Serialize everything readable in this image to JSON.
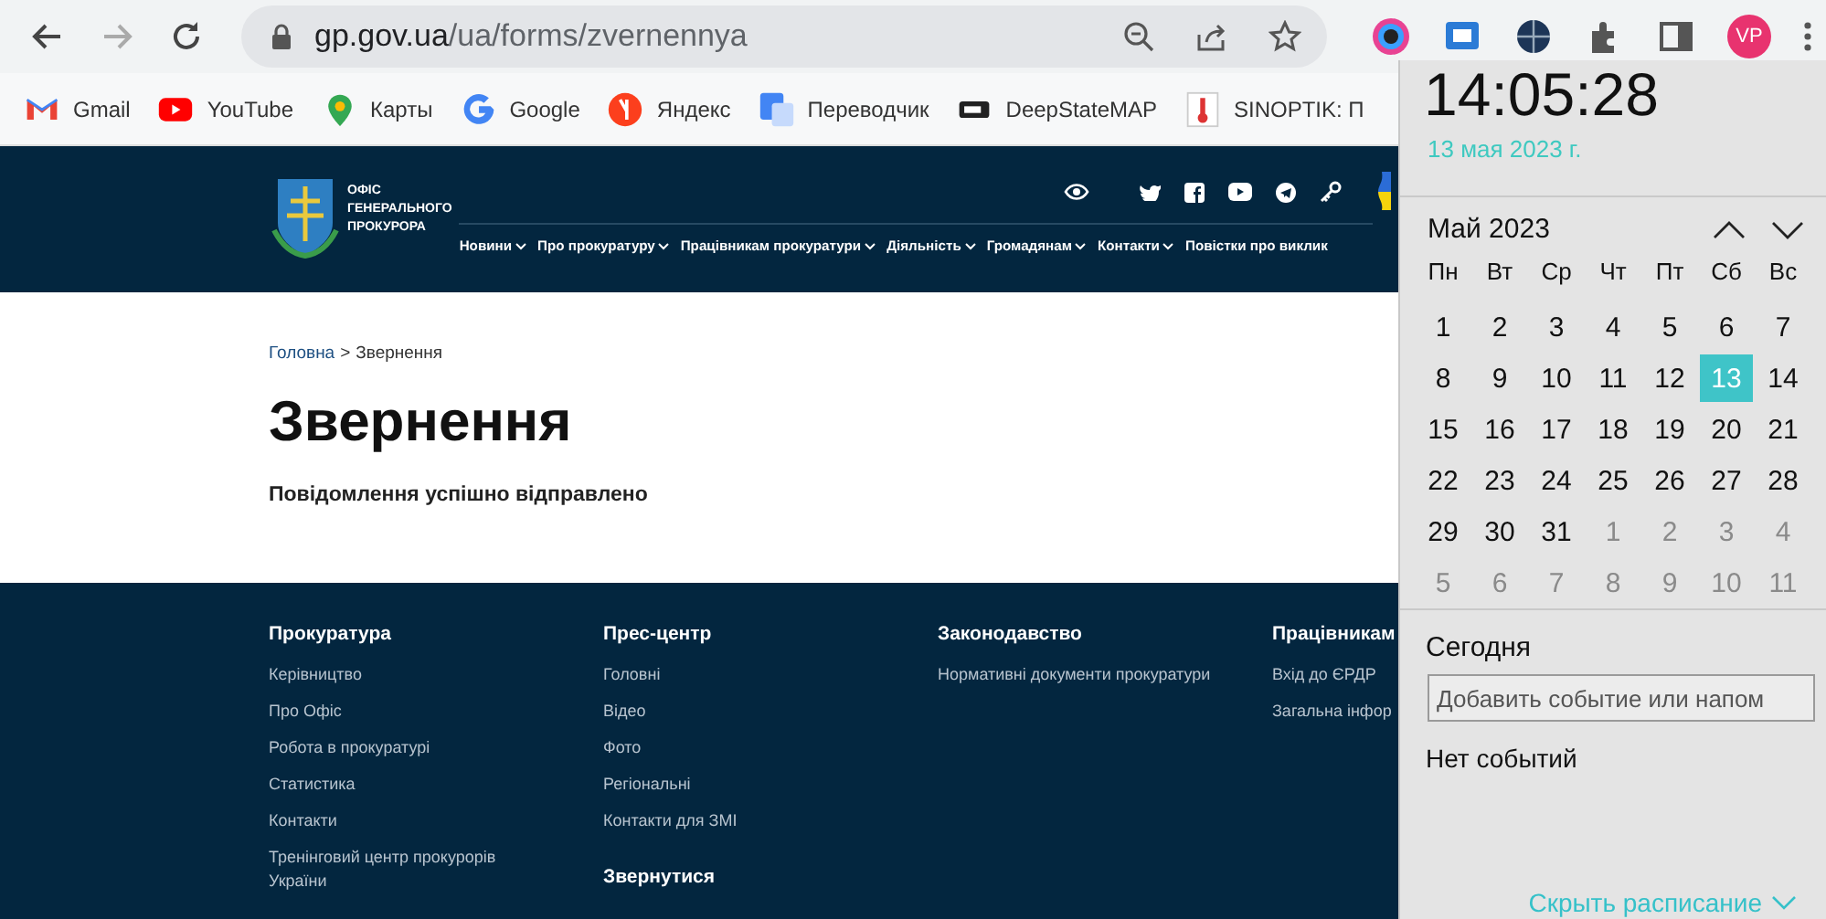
{
  "browser": {
    "url_host": "gp.gov.ua",
    "url_path": "/ua/forms/zvernennya",
    "avatar": "VP",
    "bookmarks": [
      {
        "label": "Gmail"
      },
      {
        "label": "YouTube"
      },
      {
        "label": "Карты"
      },
      {
        "label": "Google"
      },
      {
        "label": "Яндекс"
      },
      {
        "label": "Переводчик"
      },
      {
        "label": "DeepStateMAP"
      },
      {
        "label": "SINOPTIK: П"
      }
    ]
  },
  "site": {
    "logo_text": "ОФІС\nГЕНЕРАЛЬНОГО\nПРОКУРОРА",
    "nav": [
      {
        "label": "Новини",
        "has_menu": true
      },
      {
        "label": "Про прокуратуру",
        "has_menu": true
      },
      {
        "label": "Працівникам прокуратури",
        "has_menu": true
      },
      {
        "label": "Діяльність",
        "has_menu": true
      },
      {
        "label": "Громадянам",
        "has_menu": true
      },
      {
        "label": "Контакти",
        "has_menu": true
      },
      {
        "label": "Повістки про виклик",
        "has_menu": false
      }
    ],
    "breadcrumb": [
      {
        "label": "Головна",
        "link": true
      },
      {
        "label": "Звернення",
        "link": false
      }
    ],
    "breadcrumb_separator": ">",
    "title": "Звернення",
    "message": "Повідомлення успішно відправлено",
    "footer": [
      {
        "sections": [
          {
            "heading": "Прокуратура",
            "links": [
              "Керівництво",
              "Про Офіс",
              "Робота в прокуратурі",
              "Статистика",
              "Контакти",
              "Тренінговий центр прокурорів України"
            ]
          }
        ]
      },
      {
        "sections": [
          {
            "heading": "Прес-центр",
            "links": [
              "Головні",
              "Відео",
              "Фото",
              "Регіональні",
              "Контакти для ЗМІ"
            ]
          },
          {
            "heading": "Звернутися"
          }
        ]
      },
      {
        "sections": [
          {
            "heading": "Законодавство",
            "links": [
              "Нормативні документи прокуратури"
            ]
          }
        ]
      },
      {
        "sections": [
          {
            "heading": "Працівникам",
            "links": [
              "Вхід до ЄРДР",
              "Загальна інфор"
            ]
          }
        ]
      }
    ]
  },
  "calendar": {
    "time": "14:05:28",
    "date": "13 мая 2023 г.",
    "month": "Май 2023",
    "weekdays": [
      "Пн",
      "Вт",
      "Ср",
      "Чт",
      "Пт",
      "Сб",
      "Вс"
    ],
    "weeks": [
      [
        {
          "day": "1",
          "other_month": false,
          "selected": false
        },
        {
          "day": "2",
          "other_month": false,
          "selected": false
        },
        {
          "day": "3",
          "other_month": false,
          "selected": false
        },
        {
          "day": "4",
          "other_month": false,
          "selected": false
        },
        {
          "day": "5",
          "other_month": false,
          "selected": false
        },
        {
          "day": "6",
          "other_month": false,
          "selected": false
        },
        {
          "day": "7",
          "other_month": false,
          "selected": false
        }
      ],
      [
        {
          "day": "8",
          "other_month": false,
          "selected": false
        },
        {
          "day": "9",
          "other_month": false,
          "selected": false
        },
        {
          "day": "10",
          "other_month": false,
          "selected": false
        },
        {
          "day": "11",
          "other_month": false,
          "selected": false
        },
        {
          "day": "12",
          "other_month": false,
          "selected": false
        },
        {
          "day": "13",
          "other_month": false,
          "selected": true
        },
        {
          "day": "14",
          "other_month": false,
          "selected": false
        }
      ],
      [
        {
          "day": "15",
          "other_month": false,
          "selected": false
        },
        {
          "day": "16",
          "other_month": false,
          "selected": false
        },
        {
          "day": "17",
          "other_month": false,
          "selected": false
        },
        {
          "day": "18",
          "other_month": false,
          "selected": false
        },
        {
          "day": "19",
          "other_month": false,
          "selected": false
        },
        {
          "day": "20",
          "other_month": false,
          "selected": false
        },
        {
          "day": "21",
          "other_month": false,
          "selected": false
        }
      ],
      [
        {
          "day": "22",
          "other_month": false,
          "selected": false
        },
        {
          "day": "23",
          "other_month": false,
          "selected": false
        },
        {
          "day": "24",
          "other_month": false,
          "selected": false
        },
        {
          "day": "25",
          "other_month": false,
          "selected": false
        },
        {
          "day": "26",
          "other_month": false,
          "selected": false
        },
        {
          "day": "27",
          "other_month": false,
          "selected": false
        },
        {
          "day": "28",
          "other_month": false,
          "selected": false
        }
      ],
      [
        {
          "day": "29",
          "other_month": false,
          "selected": false
        },
        {
          "day": "30",
          "other_month": false,
          "selected": false
        },
        {
          "day": "31",
          "other_month": false,
          "selected": false
        },
        {
          "day": "1",
          "other_month": true,
          "selected": false
        },
        {
          "day": "2",
          "other_month": true,
          "selected": false
        },
        {
          "day": "3",
          "other_month": true,
          "selected": false
        },
        {
          "day": "4",
          "other_month": true,
          "selected": false
        }
      ],
      [
        {
          "day": "5",
          "other_month": true,
          "selected": false
        },
        {
          "day": "6",
          "other_month": true,
          "selected": false
        },
        {
          "day": "7",
          "other_month": true,
          "selected": false
        },
        {
          "day": "8",
          "other_month": true,
          "selected": false
        },
        {
          "day": "9",
          "other_month": true,
          "selected": false
        },
        {
          "day": "10",
          "other_month": true,
          "selected": false
        },
        {
          "day": "11",
          "other_month": true,
          "selected": false
        }
      ]
    ],
    "today_label": "Сегодня",
    "event_placeholder": "Добавить событие или напом",
    "no_events": "Нет событий",
    "hide_schedule": "Скрыть расписание"
  }
}
